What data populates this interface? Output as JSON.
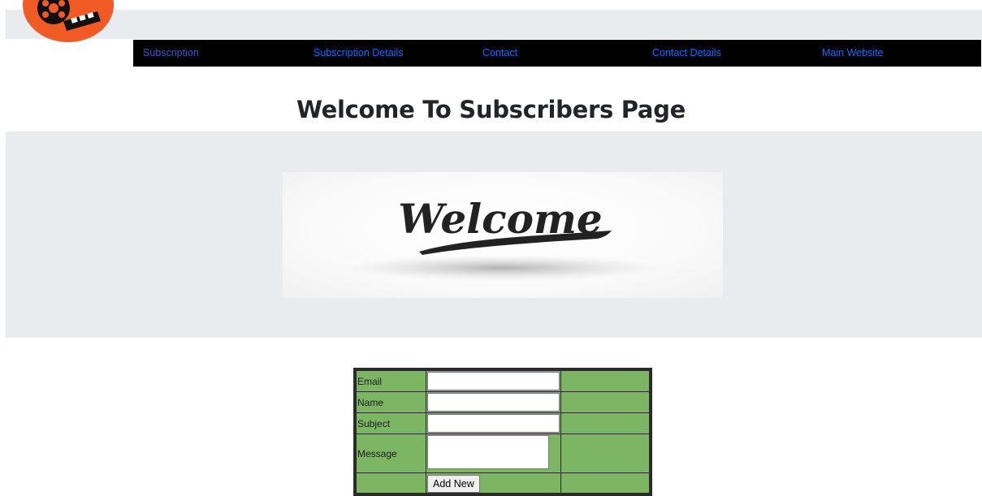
{
  "nav": {
    "items": [
      {
        "label": "Subscription"
      },
      {
        "label": "Subscription Details"
      },
      {
        "label": "Contact"
      },
      {
        "label": "Contact Details"
      },
      {
        "label": "Main Website"
      }
    ]
  },
  "main": {
    "title": "Welcome To Subscribers Page",
    "banner_text": "Welcome"
  },
  "form": {
    "fields": [
      {
        "label": "Email",
        "value": ""
      },
      {
        "label": "Name",
        "value": ""
      },
      {
        "label": "Subject",
        "value": ""
      },
      {
        "label": "Message",
        "value": ""
      }
    ],
    "submit_label": "Add New"
  },
  "colors": {
    "logo_orange": "#f15a24",
    "nav_background": "#000000",
    "nav_link": "#0d6efd",
    "jumbotron": "#e9ecef",
    "form_green": "#7db662"
  }
}
